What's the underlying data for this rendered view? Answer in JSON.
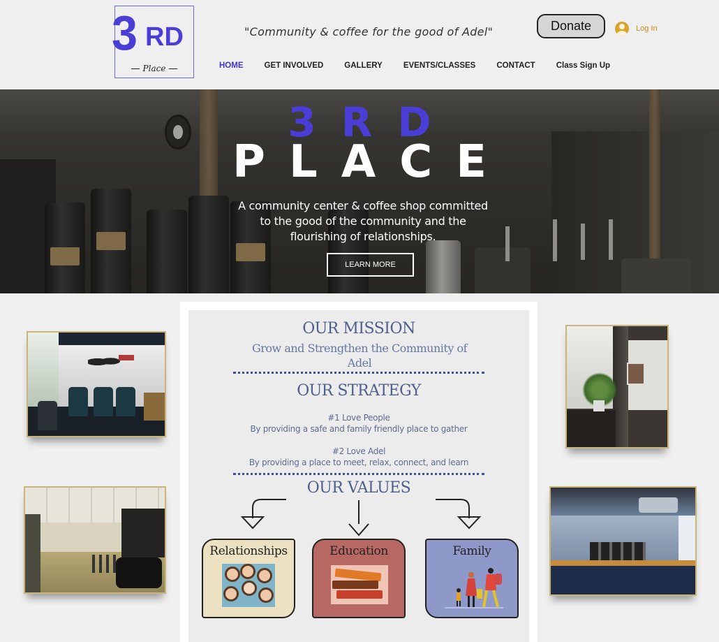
{
  "header": {
    "logo_big": "3",
    "logo_rd": "RD",
    "logo_place": "Place",
    "tagline": "\"Community & coffee for the good of Adel\"",
    "donate_label": "Donate",
    "login_label": "Log In"
  },
  "nav": {
    "items": [
      {
        "label": "HOME",
        "active": true
      },
      {
        "label": "GET INVOLVED"
      },
      {
        "label": "GALLERY"
      },
      {
        "label": "EVENTS/CLASSES"
      },
      {
        "label": "CONTACT"
      },
      {
        "label": "Class Sign Up"
      }
    ]
  },
  "hero": {
    "title_top": "3RD",
    "title_bottom": "PLACE",
    "description": "A community center & coffee shop committed to the good of the community and the flourishing of relationships.",
    "button_label": "LEARN MORE",
    "accent_color": "#4b3ed6"
  },
  "mission": {
    "heading": "OUR MISSION",
    "statement": "Grow and Strengthen the Community of Adel",
    "strategy_heading": "OUR STRATEGY",
    "strategies": [
      {
        "title": "#1 Love People",
        "text": "By providing a safe and family friendly place to gather"
      },
      {
        "title": "#2 Love Adel",
        "text": "By providing a place to meet, relax, connect, and learn"
      }
    ],
    "values_heading": "OUR VALUES",
    "values": [
      {
        "label": "Relationships",
        "color": "#ece2c2",
        "icon": "group-selfie-icon"
      },
      {
        "label": "Education",
        "color": "#b86863",
        "icon": "books-icon"
      },
      {
        "label": "Family",
        "color": "#8f99c9",
        "icon": "family-travel-icon"
      }
    ],
    "heading_color": "#4e5f8c"
  },
  "photos": [
    {
      "name": "lounge-photo"
    },
    {
      "name": "hall-photo"
    },
    {
      "name": "plant-photo"
    },
    {
      "name": "counter-photo"
    }
  ]
}
